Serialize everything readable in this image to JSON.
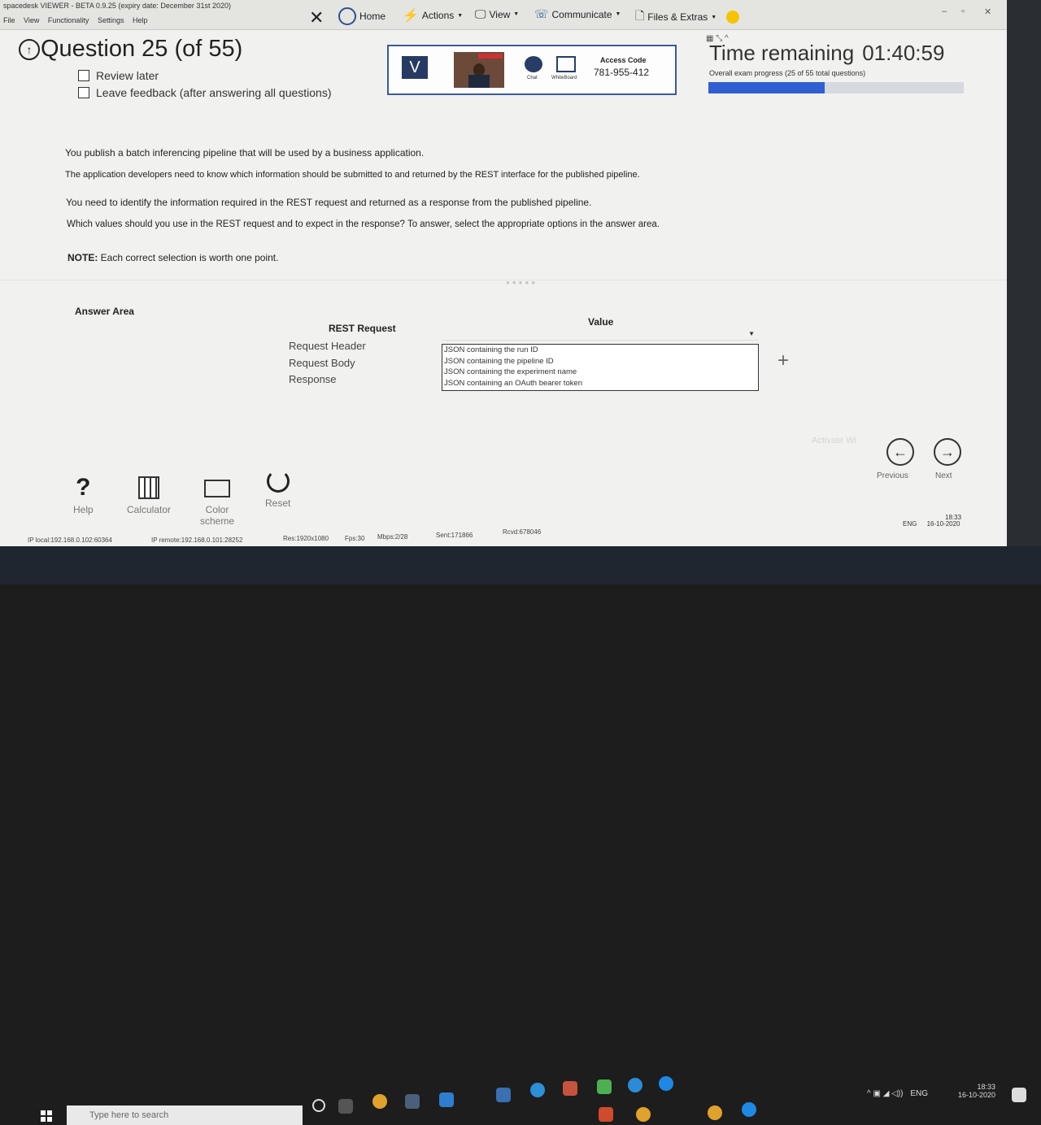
{
  "app": {
    "title": "spacedesk VIEWER - BETA 0.9.25 (expiry date: December 31st 2020)",
    "menu": [
      "File",
      "View",
      "Functionality",
      "Settings",
      "Help"
    ]
  },
  "toolbar": {
    "home": "Home",
    "actions": "Actions",
    "view": "View",
    "communicate": "Communicate",
    "files": "Files & Extras"
  },
  "exam": {
    "question_title": "Question 25 (of 55)",
    "review_later": "Review later",
    "leave_feedback": "Leave feedback (after answering all questions)",
    "time_label": "Time remaining",
    "time_value": "01:40:59",
    "progress_text": "Overall exam progress (25 of 55 total questions)",
    "progress_fraction": 0.4545
  },
  "proctor": {
    "logo": "V",
    "chat_label": "Chat",
    "whiteboard_label": "WhiteBoard",
    "access_code_title": "Access Code",
    "access_code": "781-955-412"
  },
  "question": {
    "p1": "You publish a batch inferencing pipeline that will be used by a business application.",
    "p2": "The application developers need to know which information should be submitted to and returned by the REST interface for the published pipeline.",
    "p3": "You need to identify the information required in the REST request and returned as a response from the published pipeline.",
    "p4": "Which values should you use in the REST request and to expect in the response? To answer, select the appropriate options in the answer area.",
    "note_label": "NOTE:",
    "note_text": " Each correct selection is worth one point."
  },
  "answer": {
    "title": "Answer Area",
    "col_request": "REST Request",
    "col_value": "Value",
    "rows": [
      "Request Header",
      "Request Body",
      "Response"
    ],
    "options": [
      "JSON containing the run ID",
      "JSON containing the pipeline ID",
      "JSON containing the experiment name",
      "JSON containing an OAuth bearer token"
    ]
  },
  "nav": {
    "previous": "Previous",
    "next": "Next",
    "watermark": "Activate Wi"
  },
  "tools": {
    "help": "Help",
    "calculator": "Calculator",
    "color_scheme_1": "Color",
    "color_scheme_2": "scheme",
    "reset": "Reset"
  },
  "status": {
    "local": "IP local:192.168.0.102:60364",
    "remote": "IP remote:192.168.0.101:28252",
    "res": "Res:1920x1080",
    "fps": "Fps:30",
    "mbps": "Mbps:2/28",
    "sent": "Sent:171866",
    "rcvd": "Rcvd:678046"
  },
  "inner_clock": {
    "lang": "ENG",
    "time": "18:33",
    "date": "16-10-2020"
  },
  "taskbar": {
    "search_placeholder": "Type here to search",
    "lang": "ENG",
    "time": "18:33",
    "date": "16-10-2020"
  },
  "colors": {
    "accent": "#2f5fd1",
    "proctor_border": "#3a5b9a"
  }
}
